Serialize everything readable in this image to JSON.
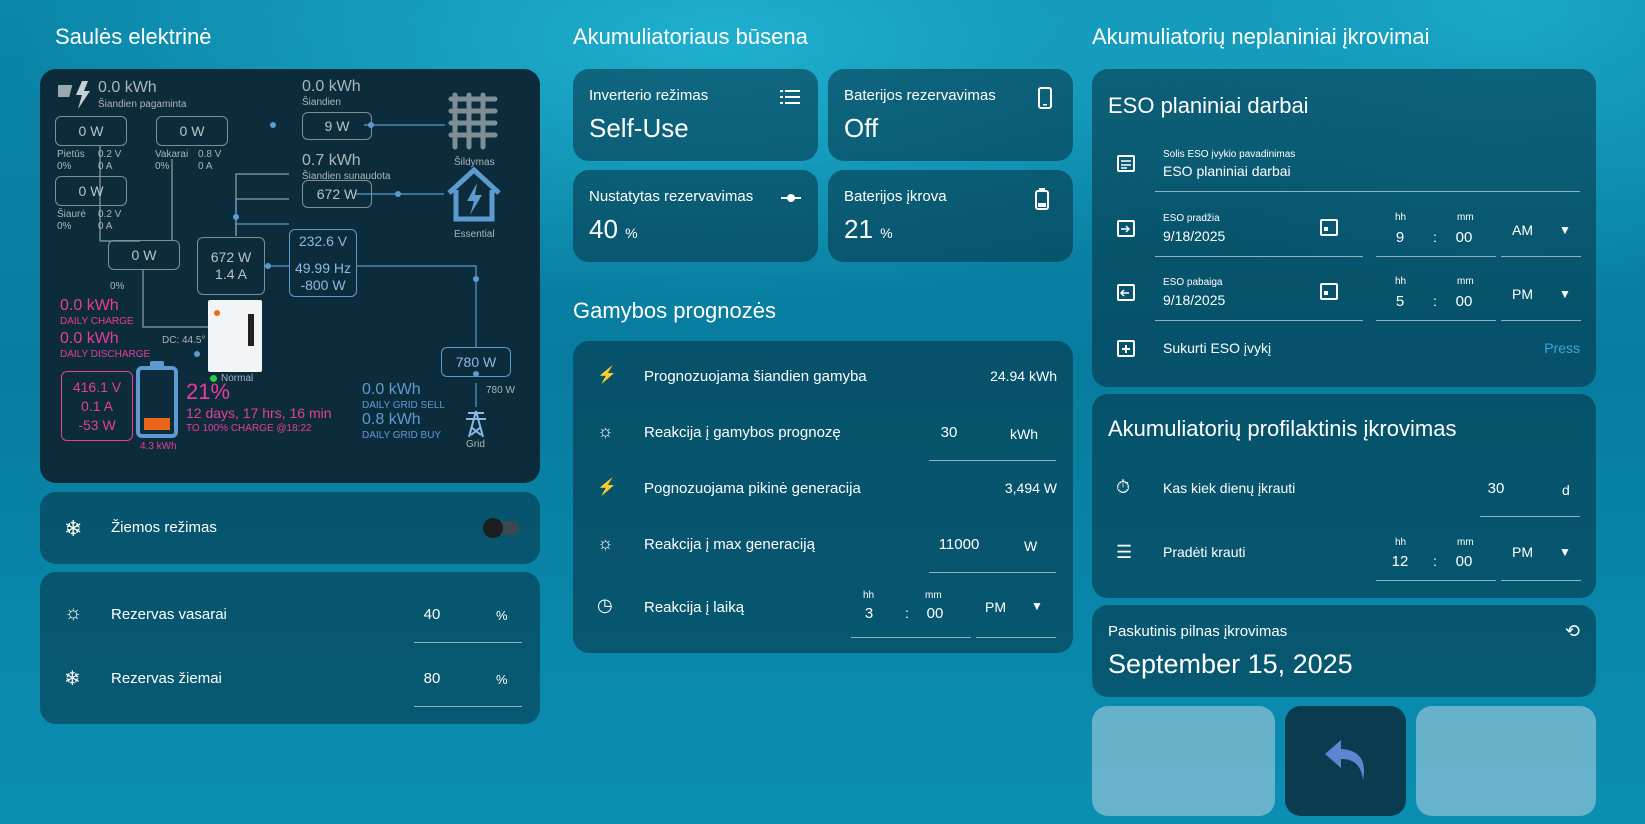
{
  "solar": {
    "title": "Saulės elektrinė",
    "pv_total": "0.0 kWh",
    "pv_total_label": "Šiandien pagaminta",
    "pv1": "0 W",
    "pv1_name": "Pietūs",
    "pv1_v": "0.2 V",
    "pv1_pct": "0%",
    "pv1_a": "0 A",
    "pv2": "0 W",
    "pv2_name": "Vakarai",
    "pv2_v": "0.8 V",
    "pv2_pct": "0%",
    "pv2_a": "0 A",
    "pv3": "0 W",
    "pv3_name": "Šiaurė",
    "pv3_v": "0.2 V",
    "pv3_pct": "0%",
    "pv3_a": "0 A",
    "pv4": "0 W",
    "pv4_pct": "0%",
    "today": "0.0 kWh",
    "today_label": "Šiandien",
    "heat": "9 W",
    "heat_label": "Šildymas",
    "essential_kwh": "0.7 kWh",
    "essential_kwh_label": "Šiandien sunaudota",
    "essential": "672 W",
    "essential_label": "Essential",
    "inv_w": "672 W",
    "inv_a": "1.4 A",
    "grid_v": "232.6 V",
    "grid_hz": "49.99 Hz",
    "grid_w": "-800 W",
    "dc_temp": "DC: 44.5°",
    "status": "Normal",
    "daily_charge": "0.0 kWh",
    "daily_charge_label": "DAILY CHARGE",
    "daily_discharge": "0.0 kWh",
    "daily_discharge_label": "DAILY DISCHARGE",
    "bat_v": "416.1 V",
    "bat_a": "0.1 A",
    "bat_w": "-53 W",
    "bat_soc": "21%",
    "bat_time": "12 days, 17 hrs, 16 min",
    "bat_to": "TO 100% CHARGE @18:22",
    "bat_cap": "4.3 kWh",
    "grid_sell": "0.0 kWh",
    "grid_sell_label": "DAILY GRID SELL",
    "grid_buy": "0.8 kWh",
    "grid_buy_label": "DAILY GRID BUY",
    "grid_box": "780 W",
    "grid_small": "780 W",
    "grid_label": "Grid",
    "soc_fill": 0.21
  },
  "winter": {
    "label": "Žiemos režimas",
    "on": false
  },
  "reserve": {
    "summer_label": "Rezervas vasarai",
    "summer_val": "40",
    "summer_unit": "%",
    "winter_label": "Rezervas žiemai",
    "winter_val": "80",
    "winter_unit": "%"
  },
  "battery": {
    "title": "Akumuliatoriaus būsena",
    "t1": "Inverterio režimas",
    "v1": "Self-Use",
    "t2": "Baterijos rezervavimas",
    "v2": "Off",
    "t3": "Nustatytas rezervavimas",
    "v3": "40",
    "u3": "%",
    "t4": "Baterijos įkrova",
    "v4": "21",
    "u4": "%"
  },
  "forecast": {
    "title": "Gamybos prognozės",
    "r1": "Prognozuojama šiandien gamyba",
    "r1v": "24.94 kWh",
    "r2": "Reakcija į gamybos prognozę",
    "r2v": "30",
    "r2u": "kWh",
    "r3": "Pognozuojama pikinė generacija",
    "r3v": "3,494 W",
    "r4": "Reakcija į max generaciją",
    "r4v": "11000",
    "r4u": "W",
    "r5": "Reakcija į laiką",
    "hh": "hh",
    "mm": "mm",
    "r5h": "3",
    "r5m": "00",
    "r5ap": "PM"
  },
  "unplanned": {
    "title": "Akumuliatorių neplaniniai įkrovimai",
    "eso_title": "ESO planiniai darbai",
    "name_label": "Solis ESO įvykio pavadinimas",
    "name_val": "ESO planiniai darbai",
    "start_label": "ESO pradžia",
    "start_date": "9/18/2025",
    "start_h": "9",
    "start_m": "00",
    "start_ap": "AM",
    "end_label": "ESO pabaiga",
    "end_date": "9/18/2025",
    "end_h": "5",
    "end_m": "00",
    "end_ap": "PM",
    "create_label": "Sukurti ESO įvykį",
    "press": "Press",
    "hh": "hh",
    "mm": "mm"
  },
  "prophy": {
    "title": "Akumuliatorių profilaktinis įkrovimas",
    "every_label": "Kas kiek dienų įkrauti",
    "every_val": "30",
    "every_unit": "d",
    "start_label": "Pradėti krauti",
    "h": "12",
    "m": "00",
    "ap": "PM",
    "hh": "hh",
    "mm": "mm"
  },
  "last": {
    "label": "Paskutinis pilnas įkrovimas",
    "date": "September 15, 2025"
  }
}
